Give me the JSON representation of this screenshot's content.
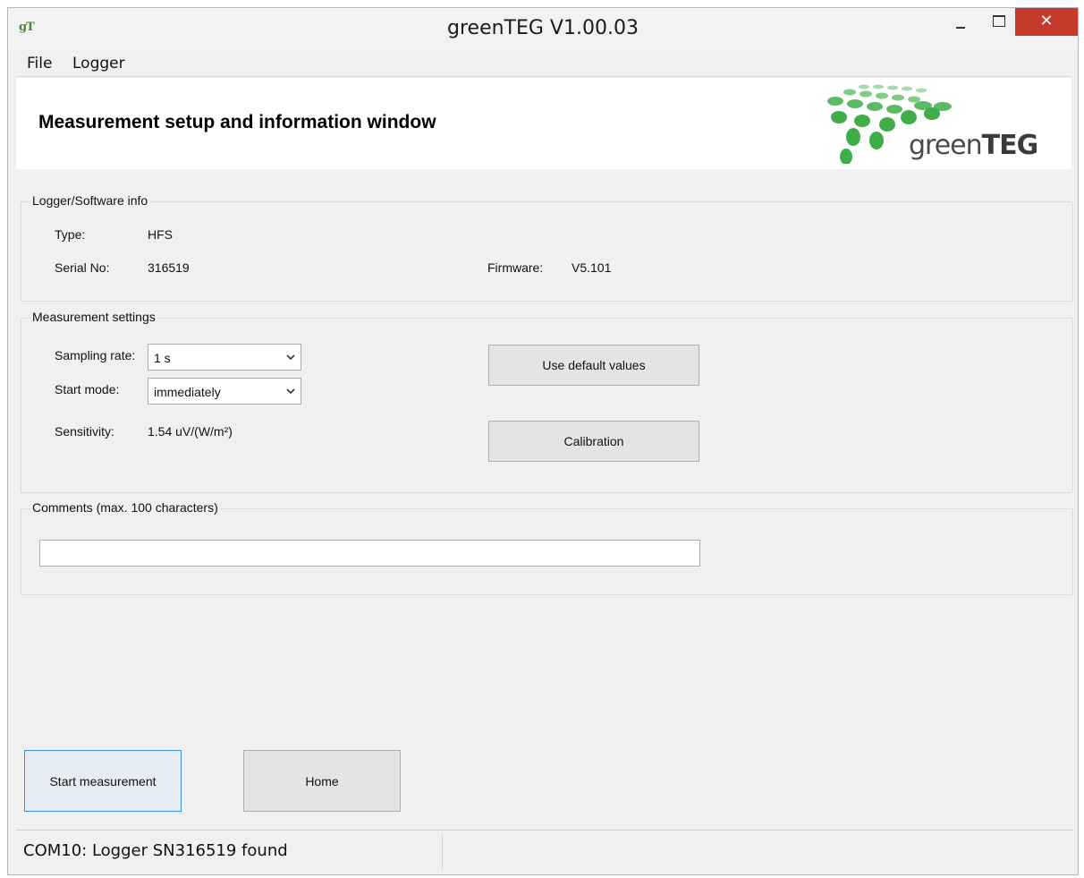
{
  "window": {
    "title": "greenTEG V1.00.03",
    "app_icon_text": "gT",
    "close_glyph": "✕"
  },
  "menu": {
    "items": [
      {
        "label": "File"
      },
      {
        "label": "Logger"
      }
    ]
  },
  "header": {
    "title": "Measurement setup and information window",
    "logo_text_a": "green",
    "logo_text_b": "TEG",
    "logo_color": "#3fae49"
  },
  "logger_info": {
    "legend": "Logger/Software info",
    "type_label": "Type:",
    "type_value": "HFS",
    "serial_label": "Serial No:",
    "serial_value": "316519",
    "firmware_label": "Firmware:",
    "firmware_value": "V5.101"
  },
  "measurement_settings": {
    "legend": "Measurement settings",
    "sampling_rate_label": "Sampling rate:",
    "sampling_rate_value": "1 s",
    "start_mode_label": "Start mode:",
    "start_mode_value": "immediately",
    "sensitivity_label": "Sensitivity:",
    "sensitivity_value": "1.54 uV/(W/m²)",
    "default_values_button": "Use default values",
    "calibration_button": "Calibration"
  },
  "comments": {
    "legend": "Comments (max. 100 characters)",
    "value": ""
  },
  "actions": {
    "start_measurement": "Start measurement",
    "home": "Home"
  },
  "status": {
    "text": "COM10: Logger SN316519 found",
    "accent_color": "#3c8fe0"
  }
}
